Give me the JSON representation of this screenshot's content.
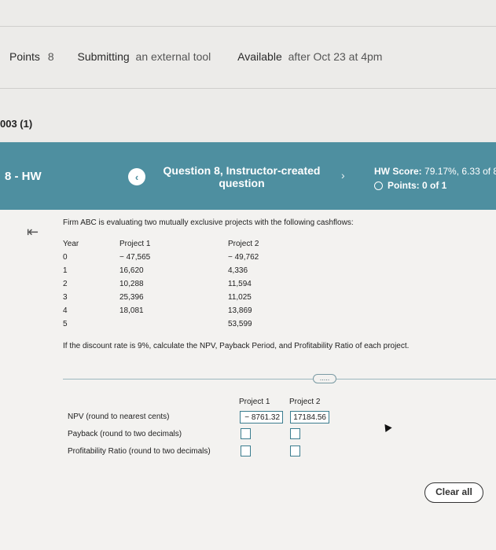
{
  "header": {
    "points_key": "Points",
    "points_value": "8",
    "submitting_key": "Submitting",
    "submitting_value": "an external tool",
    "available_key": "Available",
    "available_value": "after Oct 23 at 4pm",
    "course_code": "003 (1)"
  },
  "hw_bar": {
    "hw_label": "8 - HW",
    "prev_icon": "chevron-left-icon",
    "next_icon": "chevron-right-icon",
    "prev_glyph": "‹",
    "next_glyph": "›",
    "question_title": "Question 8, Instructor-created question",
    "score_label": "HW Score:",
    "score_value": "79.17%, 6.33 of 8",
    "points_label": "Points: 0 of 1",
    "bar_color": "#4e8fa0"
  },
  "problem": {
    "back_icon": "skip-to-first-icon",
    "back_glyph": "⇤",
    "prompt": "Firm ABC is evaluating two mutually exclusive projects with the following cashflows:",
    "table_headers": [
      "Year",
      "Project 1",
      "Project 2"
    ],
    "table_rows": [
      [
        "0",
        "− 47,565",
        "− 49,762"
      ],
      [
        "1",
        "16,620",
        "4,336"
      ],
      [
        "2",
        "10,288",
        "11,594"
      ],
      [
        "3",
        "25,396",
        "11,025"
      ],
      [
        "4",
        "18,081",
        "13,869"
      ],
      [
        "5",
        "",
        "53,599"
      ]
    ],
    "question": "If the discount rate is 9%, calculate the NPV, Payback Period, and Profitability Ratio of each project.",
    "more_dots": "....."
  },
  "answers": {
    "col_headers": [
      "Project 1",
      "Project 2"
    ],
    "npv_label": "NPV (round to nearest cents)",
    "npv_p1": "− 8761.32",
    "npv_p2": "17184.56",
    "payback_label": "Payback (round to two decimals)",
    "payback_p1": "",
    "payback_p2": "",
    "pr_label": "Profitability Ratio (round to two decimals)",
    "pr_p1": "",
    "pr_p2": "",
    "clear_label": "Clear all"
  }
}
